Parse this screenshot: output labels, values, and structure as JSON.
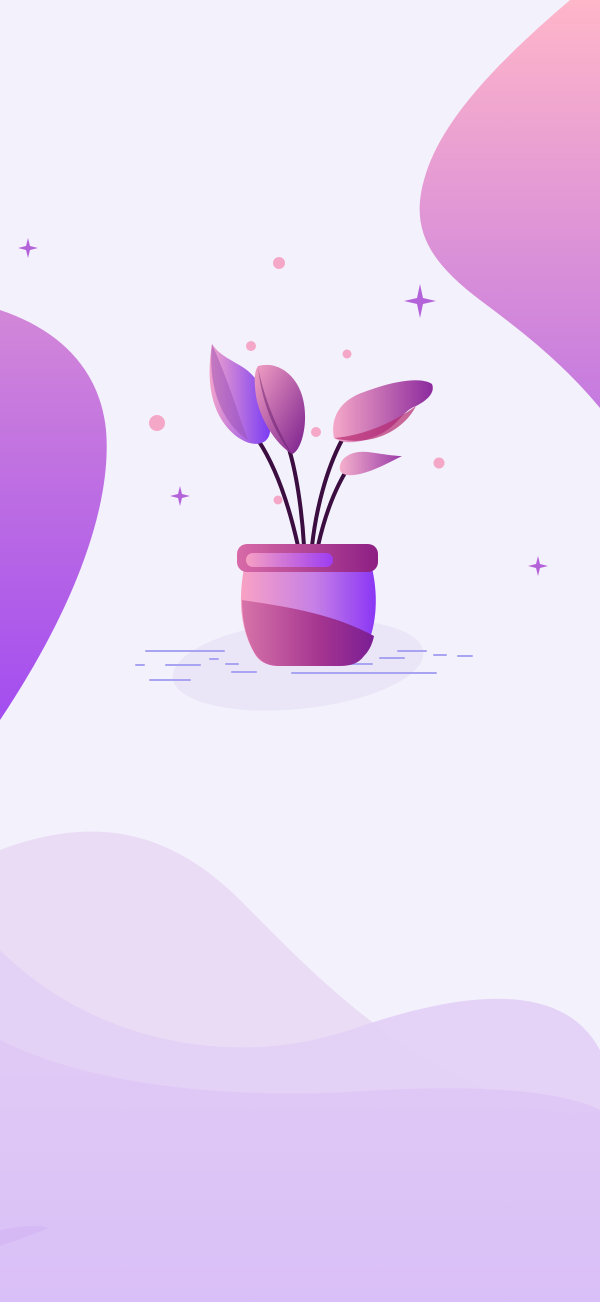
{
  "screen": {
    "description": "",
    "background": "#f3f2fc"
  },
  "colors": {
    "blob_top": "#ffb6c9",
    "blob_bottom": "#a553f0",
    "wave_light": "#ead8f5",
    "wave_mid": "#dec4f4",
    "wave_deep": "#d8bdf7",
    "pot_pink": "#f7a3c5",
    "pot_violet": "#8a36f5",
    "pot_rim": "#a4257e",
    "stem": "#3a0d3f",
    "dot_pink": "#f6a9c8",
    "sparkle": "#b35fd9",
    "floor_line": "#a7a3f2"
  },
  "icons": {
    "plant": "potted-plant-icon",
    "sparkle": "sparkle-icon"
  }
}
